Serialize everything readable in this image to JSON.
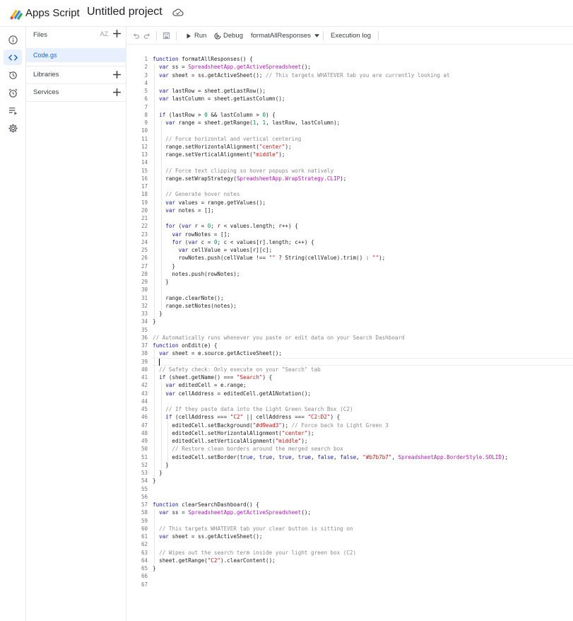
{
  "header": {
    "app_name": "Apps Script",
    "project_title": "Untitled project"
  },
  "rail": {
    "items": [
      "overview",
      "editor",
      "executions-history",
      "triggers",
      "executions",
      "project-settings"
    ]
  },
  "files_panel": {
    "files_label": "Files",
    "sort_label": "AZ",
    "file_name": "Code.gs",
    "libraries_label": "Libraries",
    "services_label": "Services"
  },
  "toolbar": {
    "run_label": "Run",
    "debug_label": "Debug",
    "function_select": "formatAllResponses",
    "execution_log_label": "Execution log"
  },
  "code": {
    "lines": [
      "function formatAllResponses() {",
      "  var ss = SpreadsheetApp.getActiveSpreadsheet();",
      "  var sheet = ss.getActiveSheet(); // This targets WHATEVER tab you are currently looking at",
      "",
      "  var lastRow = sheet.getLastRow();",
      "  var lastColumn = sheet.getLastColumn();",
      "",
      "  if (lastRow > 0 && lastColumn > 0) {",
      "    var range = sheet.getRange(1, 1, lastRow, lastColumn);",
      "",
      "    // Force horizontal and vertical centering",
      "    range.setHorizontalAlignment(\"center\");",
      "    range.setVerticalAlignment(\"middle\");",
      "",
      "    // Force text clipping so hover popups work natively",
      "    range.setWrapStrategy(SpreadsheetApp.WrapStrategy.CLIP);",
      "",
      "    // Generate hover notes",
      "    var values = range.getValues();",
      "    var notes = [];",
      "",
      "    for (var r = 0; r < values.length; r++) {",
      "      var rowNotes = [];",
      "      for (var c = 0; c < values[r].length; c++) {",
      "        var cellValue = values[r][c];",
      "        rowNotes.push(cellValue !== \"\" ? String(cellValue).trim() : \"\");",
      "      }",
      "      notes.push(rowNotes);",
      "    }",
      "",
      "    range.clearNote();",
      "    range.setNotes(notes);",
      "  }",
      "}",
      "",
      "// Automatically runs whenever you paste or edit data on your Search Dashboard",
      "function onEdit(e) {",
      "  var sheet = e.source.getActiveSheet();",
      "",
      "  // Safety check: Only execute on your \"Search\" tab",
      "  if (sheet.getName() === \"Search\") {",
      "    var editedCell = e.range;",
      "    var cellAddress = editedCell.getA1Notation();",
      "",
      "    // If they paste data into the Light Green Search Box (C2)",
      "    if (cellAddress === \"C2\" || cellAddress === \"C2:D2\") {",
      "      editedCell.setBackground(\"#d9ead3\"); // Force back to Light Green 3",
      "      editedCell.setHorizontalAlignment(\"center\");",
      "      editedCell.setVerticalAlignment(\"middle\");",
      "      // Restore clean borders around the merged search box",
      "      editedCell.setBorder(true, true, true, true, false, false, \"#b7b7b7\", SpreadsheetApp.BorderStyle.SOLID);",
      "    }",
      "  }",
      "}",
      "",
      "",
      "function clearSearchDashboard() {",
      "  var ss = SpreadsheetApp.getActiveSpreadsheet();",
      "",
      "  // This targets WHATEVER tab your clear button is sitting on",
      "  var sheet = ss.getActiveSheet();",
      "",
      "  // Wipes out the search term inside your light green box (C2)",
      "  sheet.getRange(\"C2\").clearContent();",
      "}",
      "",
      ""
    ]
  }
}
